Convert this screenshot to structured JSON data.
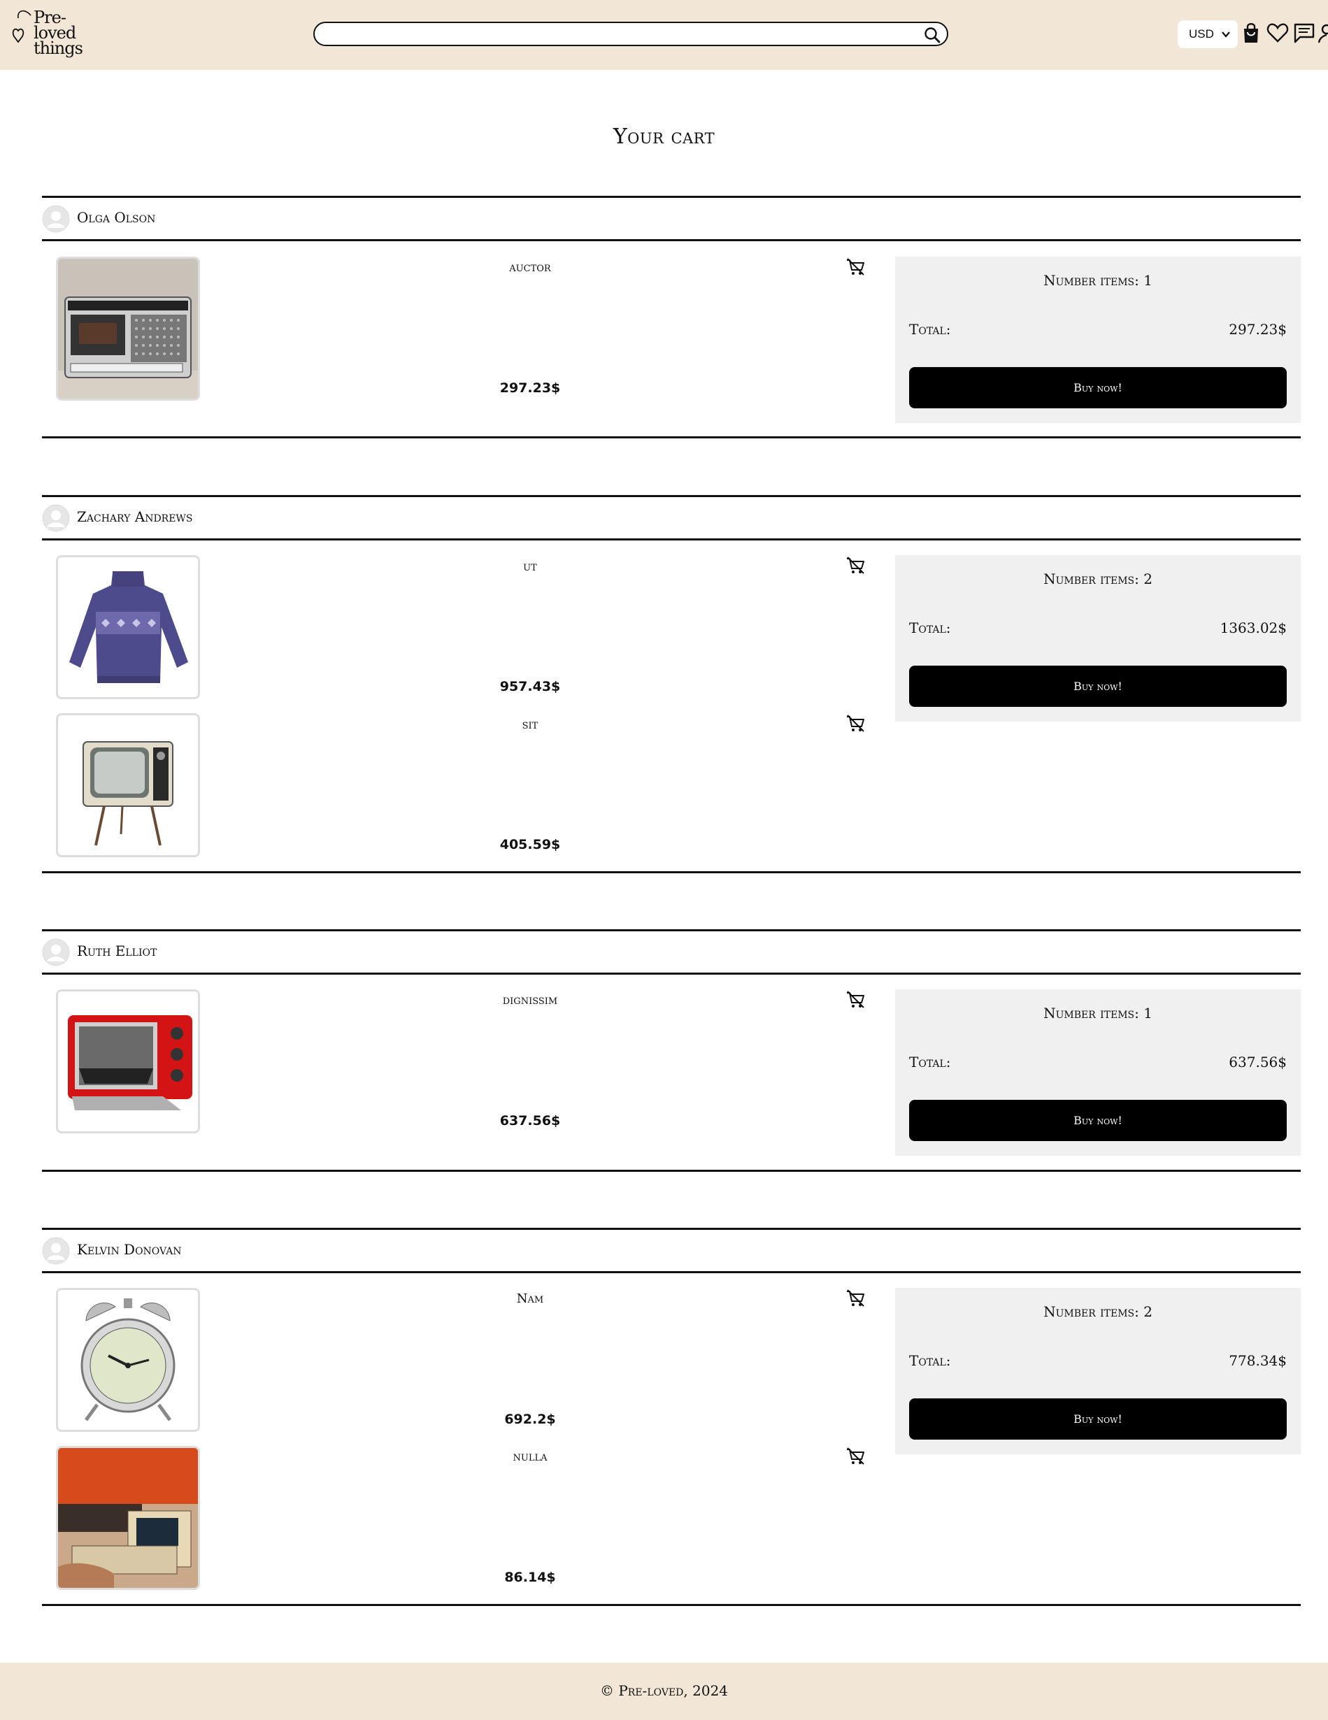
{
  "header": {
    "logo": {
      "line1": "Pre-",
      "line2": "loved",
      "line3": "things"
    },
    "search": {
      "value": "",
      "placeholder": ""
    },
    "currency": {
      "selected": "USD"
    },
    "icons": [
      "search-icon",
      "chevron-down-icon",
      "shopping-bag-icon",
      "heart-icon",
      "chat-icon",
      "user-icon"
    ]
  },
  "page": {
    "title": "Your cart"
  },
  "sellers": [
    {
      "name": "Olga Olson",
      "items": [
        {
          "name": "auctor",
          "price": "297.23$",
          "image": "cassette-radio"
        }
      ],
      "summary": {
        "count_label": "Number items: 1",
        "total_label": "Total:",
        "total_value": "297.23$",
        "buy_label": "Buy now!"
      }
    },
    {
      "name": "Zachary Andrews",
      "items": [
        {
          "name": "ut",
          "price": "957.43$",
          "image": "sweater"
        },
        {
          "name": "sit",
          "price": "405.59$",
          "image": "retro-tv"
        }
      ],
      "summary": {
        "count_label": "Number items: 2",
        "total_label": "Total:",
        "total_value": "1363.02$",
        "buy_label": "Buy now!"
      }
    },
    {
      "name": "Ruth Elliot",
      "items": [
        {
          "name": "dignissim",
          "price": "637.56$",
          "image": "toaster-oven"
        }
      ],
      "summary": {
        "count_label": "Number items: 1",
        "total_label": "Total:",
        "total_value": "637.56$",
        "buy_label": "Buy now!"
      }
    },
    {
      "name": "Kelvin Donovan",
      "items": [
        {
          "name": "Nam",
          "price": "692.2$",
          "image": "alarm-clock"
        },
        {
          "name": "nulla",
          "price": "86.14$",
          "image": "magazine"
        }
      ],
      "summary": {
        "count_label": "Number items: 2",
        "total_label": "Total:",
        "total_value": "778.34$",
        "buy_label": "Buy now!"
      }
    }
  ],
  "footer": {
    "text": "© Pre-loved, 2024"
  },
  "colors": {
    "header_bg": "#f2e7d6",
    "summary_bg": "#f0f0f0",
    "button_bg": "#000000"
  }
}
